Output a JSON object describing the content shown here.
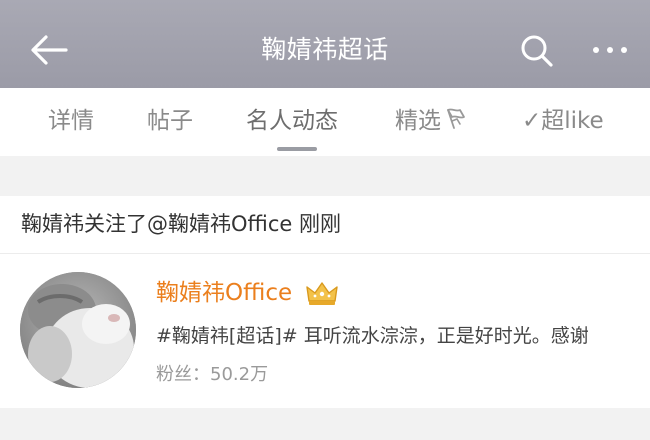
{
  "header": {
    "title": "鞠婧祎超话",
    "back_icon": "arrow-left-icon",
    "search_icon": "search-icon",
    "more_icon": "more-dots-icon"
  },
  "tabs": [
    {
      "label": "详情"
    },
    {
      "label": "帖子"
    },
    {
      "label": "名人动态",
      "active": true
    },
    {
      "label": "精选",
      "icon": "flag-icon"
    },
    {
      "label": "✓超like"
    }
  ],
  "activity": {
    "text": "鞠婧祎关注了@鞠婧祎Office 刚刚"
  },
  "user_card": {
    "name": "鞠婧祎Office",
    "badge_icon": "crown-icon",
    "description": "#鞠婧祎[超话]#    耳听流水淙淙，正是好时光。感谢",
    "fans": "粉丝：50.2万"
  },
  "colors": {
    "header_bg": "#9f9fab",
    "name_orange": "#eb7f1d",
    "page_bg": "#f2f2f2"
  }
}
